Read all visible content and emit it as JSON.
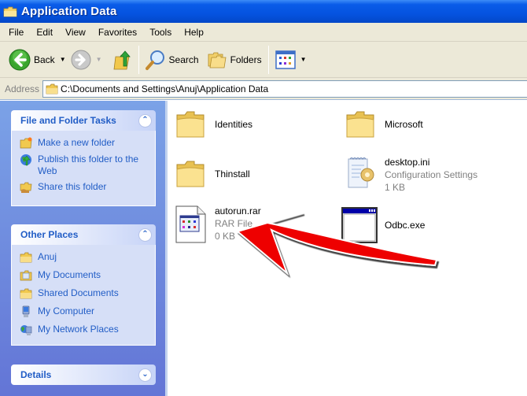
{
  "window": {
    "title": "Application Data"
  },
  "menu": {
    "items": [
      "File",
      "Edit",
      "View",
      "Favorites",
      "Tools",
      "Help"
    ]
  },
  "toolbar": {
    "back_label": "Back",
    "search_label": "Search",
    "folders_label": "Folders"
  },
  "address": {
    "label": "Address",
    "value": "C:\\Documents and Settings\\Anuj\\Application Data"
  },
  "sidebar": {
    "file_tasks": {
      "title": "File and Folder Tasks",
      "items": [
        {
          "label": "Make a new folder",
          "icon": "new-folder-icon"
        },
        {
          "label": "Publish this folder to the Web",
          "icon": "publish-web-icon"
        },
        {
          "label": "Share this folder",
          "icon": "share-folder-icon"
        }
      ]
    },
    "other_places": {
      "title": "Other Places",
      "items": [
        {
          "label": "Anuj",
          "icon": "folder-icon"
        },
        {
          "label": "My Documents",
          "icon": "my-documents-icon"
        },
        {
          "label": "Shared Documents",
          "icon": "folder-icon"
        },
        {
          "label": "My Computer",
          "icon": "my-computer-icon"
        },
        {
          "label": "My Network Places",
          "icon": "network-places-icon"
        }
      ]
    },
    "details": {
      "title": "Details"
    }
  },
  "files": [
    {
      "name": "Identities",
      "type": "folder"
    },
    {
      "name": "Microsoft",
      "type": "folder"
    },
    {
      "name": "Thinstall",
      "type": "folder"
    },
    {
      "name": "desktop.ini",
      "subtitle": "Configuration Settings",
      "size": "1 KB",
      "type": "config"
    },
    {
      "name": "autorun.rar",
      "subtitle": "RAR File",
      "size": "0 KB",
      "type": "rar"
    },
    {
      "name": "Odbc.exe",
      "type": "exe"
    }
  ],
  "annotation": {
    "type": "arrow",
    "color": "#ee0000",
    "points_to": "autorun.rar"
  }
}
